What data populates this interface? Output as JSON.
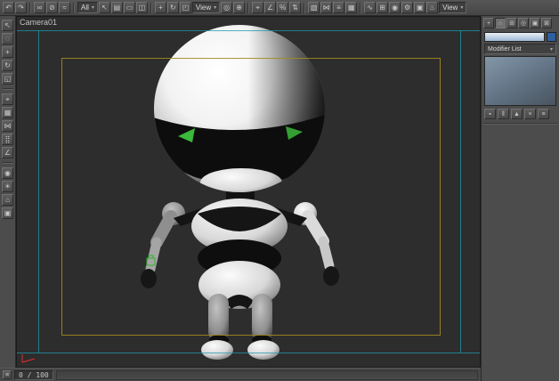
{
  "theme": {
    "ui_bg": "#4c4c4c",
    "viewport_bg": "#2d2d2d",
    "accent_cyan": "#1e9aae",
    "accent_yellow": "#a38a1f",
    "eye_green": "#3cb83c",
    "helper_green": "#2db42d",
    "axis_red": "#cc2a2a",
    "stack_blue": "#8497a9"
  },
  "icons": {
    "chevron_down": "▾"
  },
  "top_toolbar": {
    "items": [
      {
        "name": "undo-icon",
        "glyph": "↶"
      },
      {
        "name": "redo-icon",
        "glyph": "↷"
      },
      {
        "type": "sep"
      },
      {
        "name": "select-link-icon",
        "glyph": "∞"
      },
      {
        "name": "unlink-icon",
        "glyph": "⊘"
      },
      {
        "name": "bind-spacewarp-icon",
        "glyph": "≈"
      },
      {
        "type": "sep"
      },
      {
        "type": "dropdown",
        "name": "selection-filter-dropdown",
        "label": "All"
      },
      {
        "name": "select-object-icon",
        "glyph": "↖"
      },
      {
        "name": "select-by-name-icon",
        "glyph": "▤"
      },
      {
        "name": "selection-region-icon",
        "glyph": "▭"
      },
      {
        "name": "window-crossing-icon",
        "glyph": "◫"
      },
      {
        "type": "sep"
      },
      {
        "name": "select-move-icon",
        "glyph": "+"
      },
      {
        "name": "select-rotate-icon",
        "glyph": "↻"
      },
      {
        "name": "select-scale-icon",
        "glyph": "◰"
      },
      {
        "type": "dropdown",
        "name": "reference-coordinate-dropdown",
        "label": "View"
      },
      {
        "name": "use-pivot-icon",
        "glyph": "◎"
      },
      {
        "name": "select-manipulate-icon",
        "glyph": "⊕"
      },
      {
        "type": "sep"
      },
      {
        "name": "snap-toggle-icon",
        "glyph": "⌖"
      },
      {
        "name": "angle-snap-icon",
        "glyph": "∠"
      },
      {
        "name": "percent-snap-icon",
        "glyph": "%"
      },
      {
        "name": "spinner-snap-icon",
        "glyph": "⇅"
      },
      {
        "type": "sep"
      },
      {
        "name": "named-selection-icon",
        "glyph": "▧"
      },
      {
        "name": "mirror-icon",
        "glyph": "⋈"
      },
      {
        "name": "align-icon",
        "glyph": "≡"
      },
      {
        "name": "layer-manager-icon",
        "glyph": "▦"
      },
      {
        "type": "sep"
      },
      {
        "name": "curve-editor-icon",
        "glyph": "∿"
      },
      {
        "name": "schematic-view-icon",
        "glyph": "⊞"
      },
      {
        "name": "material-editor-icon",
        "glyph": "◉"
      },
      {
        "name": "render-setup-icon",
        "glyph": "⚙"
      },
      {
        "name": "rendered-frame-icon",
        "glyph": "▣"
      },
      {
        "name": "render-production-icon",
        "glyph": "♨"
      },
      {
        "type": "dropdown",
        "name": "view-selector-dropdown",
        "label": "View"
      }
    ]
  },
  "left_toolbar": {
    "items": [
      {
        "name": "select-arrow-icon",
        "glyph": "↖"
      },
      {
        "name": "lasso-select-icon",
        "glyph": "◌"
      },
      {
        "name": "move-tool-icon",
        "glyph": "+"
      },
      {
        "name": "rotate-tool-icon",
        "glyph": "↻"
      },
      {
        "name": "scale-tool-icon",
        "glyph": "◱"
      },
      {
        "type": "sep"
      },
      {
        "name": "snap-tool-icon",
        "glyph": "⌖"
      },
      {
        "name": "grid-toggle-icon",
        "glyph": "▦"
      },
      {
        "name": "mirror-tool-icon",
        "glyph": "⋈"
      },
      {
        "name": "array-tool-icon",
        "glyph": "⣿"
      },
      {
        "name": "measure-tool-icon",
        "glyph": "∠"
      },
      {
        "type": "sep"
      },
      {
        "name": "camera-create-icon",
        "glyph": "◉"
      },
      {
        "name": "light-create-icon",
        "glyph": "☀"
      },
      {
        "name": "helpers-icon",
        "glyph": "⌂"
      },
      {
        "name": "display-toggle-icon",
        "glyph": "▣"
      }
    ]
  },
  "viewport": {
    "label": "Camera01"
  },
  "right_panel": {
    "tabs": [
      {
        "name": "create-tab-icon",
        "glyph": "+"
      },
      {
        "name": "modify-tab-icon",
        "glyph": "∩",
        "active": true
      },
      {
        "name": "hierarchy-tab-icon",
        "glyph": "⊞"
      },
      {
        "name": "motion-tab-icon",
        "glyph": "◎"
      },
      {
        "name": "display-tab-icon",
        "glyph": "▣"
      },
      {
        "name": "utilities-tab-icon",
        "glyph": "⊠"
      }
    ],
    "object_name_value": "",
    "object_color": "#2e5f9e",
    "modifier_list_label": "Modifier List",
    "stack_buttons": [
      {
        "name": "pin-stack-button",
        "glyph": "▪"
      },
      {
        "name": "show-end-result-button",
        "glyph": "‖"
      },
      {
        "name": "make-unique-button",
        "glyph": "▲"
      },
      {
        "name": "remove-modifier-button",
        "glyph": "×"
      },
      {
        "name": "configure-modifier-sets-button",
        "glyph": "≡"
      }
    ]
  },
  "timeline": {
    "frame_counter": "0 / 100",
    "mini_button_glyph": "≡"
  }
}
